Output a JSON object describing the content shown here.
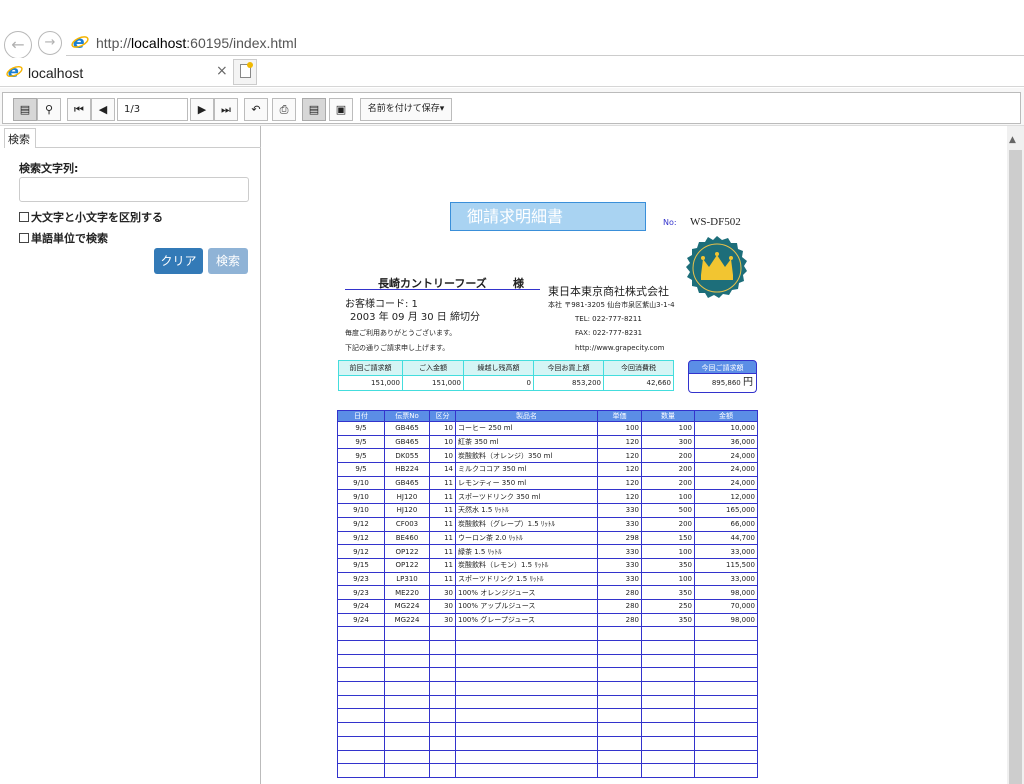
{
  "browser": {
    "url_prefix": "http://",
    "url_host": "localhost",
    "url_rest": ":60195/index.html",
    "tab_title": "localhost",
    "tab_close": "×"
  },
  "toolbar": {
    "page_value": "1/3",
    "save_label": "名前を付けて保存▾"
  },
  "sidebar": {
    "tab_label": "検索",
    "search_label": "検索文字列:",
    "search_placeholder": "",
    "case_label": "大文字と小文字を区別する",
    "word_label": "単語単位で検索",
    "clear_label": "クリア",
    "search_label_btn": "検索"
  },
  "report": {
    "title": "御請求明細書",
    "no_label": "No:",
    "no_value": "WS-DF502",
    "customer": "長崎カントリーフーズ",
    "sama": "様",
    "customer_code": "お客様コード:  1",
    "date_text": "2003 年  09 月  30 日 締切分",
    "thanks1": "毎度ご利用ありがとうございます。",
    "thanks2": "下記の通りご請求申し上げます。",
    "company": "東日本東京商社株式会社",
    "address": "本社   〒981-3205  仙台市泉区紫山3-1-4",
    "tel": "TEL: 022-777-8211",
    "fax": "FAX: 022-777-8231",
    "url": "http://www.grapecity.com",
    "summary_headers": [
      "前回ご請求額",
      "ご入金額",
      "繰越し残高額",
      "今回お買上額",
      "今回消費税"
    ],
    "summary_values": [
      "151,000",
      "151,000",
      "0",
      "853,200",
      "42,660"
    ],
    "current_head": "今回ご請求額",
    "current_value": "895,860",
    "current_unit": "円",
    "detail_headers": [
      "日付",
      "伝票No",
      "区分",
      "製品名",
      "単価",
      "数量",
      "金額"
    ],
    "rows": [
      [
        "9/5",
        "GB465",
        "10",
        "コーヒー 250 ml",
        "100",
        "100",
        "10,000"
      ],
      [
        "9/5",
        "GB465",
        "10",
        "紅茶 350 ml",
        "120",
        "300",
        "36,000"
      ],
      [
        "9/5",
        "DK055",
        "10",
        "炭酸飲料（オレンジ）350 ml",
        "120",
        "200",
        "24,000"
      ],
      [
        "9/5",
        "HB224",
        "14",
        "ミルクココア 350 ml",
        "120",
        "200",
        "24,000"
      ],
      [
        "9/10",
        "GB465",
        "11",
        "レモンティー 350 ml",
        "120",
        "200",
        "24,000"
      ],
      [
        "9/10",
        "HJ120",
        "11",
        "スポーツドリンク 350 ml",
        "120",
        "100",
        "12,000"
      ],
      [
        "9/10",
        "HJ120",
        "11",
        "天然水 1.5 ﾘｯﾄﾙ",
        "330",
        "500",
        "165,000"
      ],
      [
        "9/12",
        "CF003",
        "11",
        "炭酸飲料（グレープ）1.5 ﾘｯﾄﾙ",
        "330",
        "200",
        "66,000"
      ],
      [
        "9/12",
        "BE460",
        "11",
        "ウーロン茶 2.0 ﾘｯﾄﾙ",
        "298",
        "150",
        "44,700"
      ],
      [
        "9/12",
        "OP122",
        "11",
        "緑茶 1.5 ﾘｯﾄﾙ",
        "330",
        "100",
        "33,000"
      ],
      [
        "9/15",
        "OP122",
        "11",
        "炭酸飲料（レモン）1.5 ﾘｯﾄﾙ",
        "330",
        "350",
        "115,500"
      ],
      [
        "9/23",
        "LP310",
        "11",
        "スポーツドリンク 1.5 ﾘｯﾄﾙ",
        "330",
        "100",
        "33,000"
      ],
      [
        "9/23",
        "ME220",
        "30",
        "100% オレンジジュース",
        "280",
        "350",
        "98,000"
      ],
      [
        "9/24",
        "MG224",
        "30",
        "100% アップルジュース",
        "280",
        "250",
        "70,000"
      ],
      [
        "9/24",
        "MG224",
        "30",
        "100% グレープジュース",
        "280",
        "350",
        "98,000"
      ]
    ],
    "empty_rows": 11
  }
}
